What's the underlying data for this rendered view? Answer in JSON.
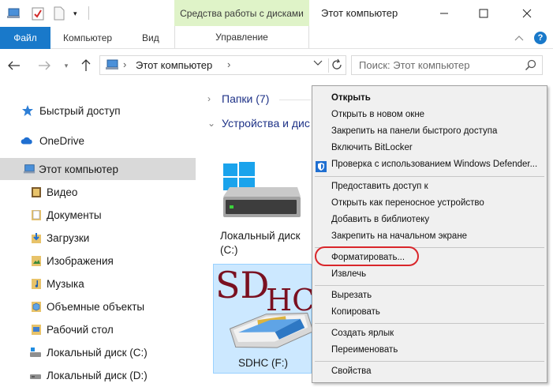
{
  "window": {
    "title": "Этот компьютер",
    "tools_tab": "Средства работы с дисками",
    "controls": [
      "minimize-icon",
      "maximize-icon",
      "close-icon"
    ]
  },
  "ribbon": {
    "tabs": [
      "Файл",
      "Компьютер",
      "Вид"
    ],
    "manage_tab": "Управление"
  },
  "address": {
    "path": "Этот компьютер",
    "search_placeholder": "Поиск: Этот компьютер"
  },
  "sidebar": {
    "quick_access": "Быстрый доступ",
    "onedrive": "OneDrive",
    "this_pc": "Этот компьютер",
    "items": [
      {
        "label": "Видео",
        "icon": "video-folder-icon"
      },
      {
        "label": "Документы",
        "icon": "documents-folder-icon"
      },
      {
        "label": "Загрузки",
        "icon": "downloads-folder-icon"
      },
      {
        "label": "Изображения",
        "icon": "pictures-folder-icon"
      },
      {
        "label": "Музыка",
        "icon": "music-folder-icon"
      },
      {
        "label": "Объемные объекты",
        "icon": "3d-objects-folder-icon"
      },
      {
        "label": "Рабочий стол",
        "icon": "desktop-folder-icon"
      },
      {
        "label": "Локальный диск (C:)",
        "icon": "drive-icon"
      },
      {
        "label": "Локальный диск (D:)",
        "icon": "drive-icon"
      }
    ]
  },
  "content": {
    "folders_group": "Папки (7)",
    "devices_group": "Устройства и дис",
    "drive_c_label": [
      "Локальный диск",
      "(C:)"
    ],
    "sdhc_name": "SDHC (F:)",
    "sdhc_logo": "SDHC",
    "sdhc_logo_parts": {
      "sd": "SD",
      "hc": "HC"
    }
  },
  "context_menu": {
    "items": [
      {
        "label": "Открыть",
        "bold": true
      },
      {
        "label": "Открыть в новом окне"
      },
      {
        "label": "Закрепить на панели быстрого доступа"
      },
      {
        "label": "Включить BitLocker"
      },
      {
        "label": "Проверка с использованием Windows Defender..."
      },
      {
        "label": "Предоставить доступ к"
      },
      {
        "label": "Открыть как переносное устройство"
      },
      {
        "label": "Добавить в библиотеку"
      },
      {
        "label": "Закрепить на начальном экране"
      },
      {
        "label": "Форматировать..."
      },
      {
        "label": "Извлечь"
      },
      {
        "label": "Вырезать"
      },
      {
        "label": "Копировать"
      },
      {
        "label": "Создать ярлык"
      },
      {
        "label": "Переименовать"
      },
      {
        "label": "Свойства"
      }
    ],
    "highlight_color": "#d9262b"
  },
  "colors": {
    "accent": "#1979ca",
    "tools_tab_bg": "#dff3c8",
    "selection": "#cce8ff",
    "sidebar_selected": "#d9d9d9"
  }
}
